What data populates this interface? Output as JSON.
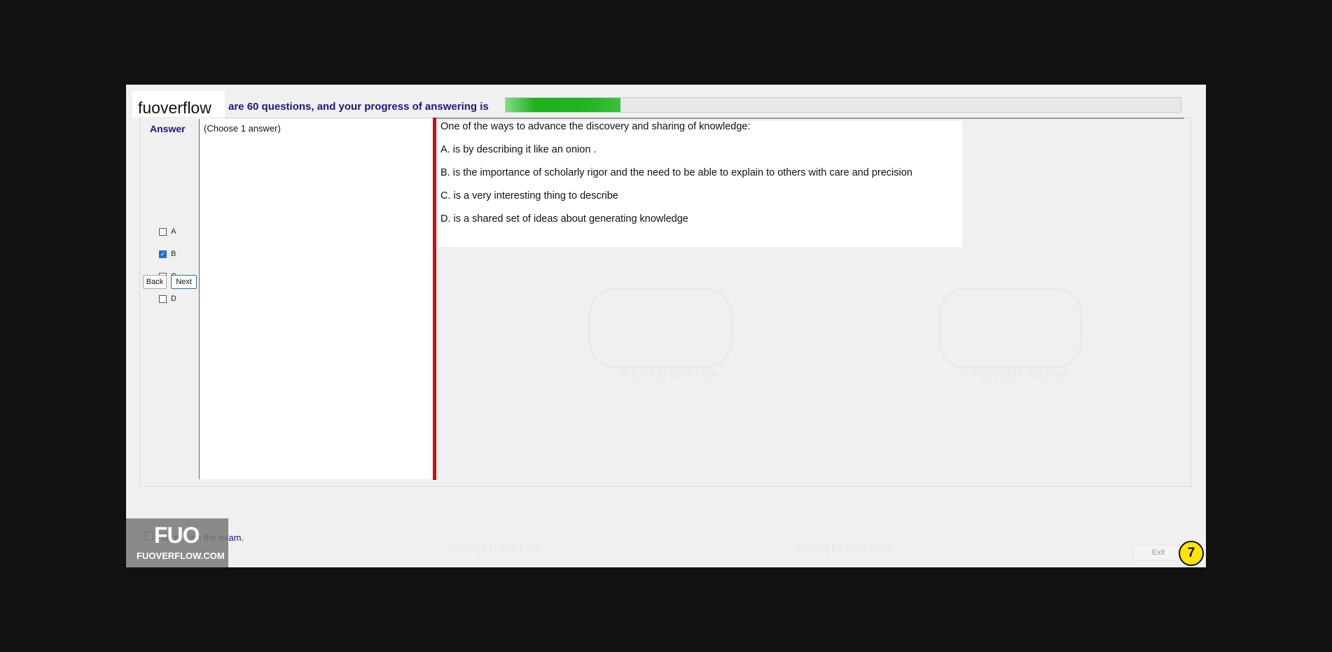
{
  "brand": {
    "name": "fuoverflow"
  },
  "header": {
    "progress_text": "are 60 questions, and your progress of answering is",
    "progress_fraction": 0.17
  },
  "answer": {
    "title": "Answer",
    "options": [
      {
        "label": "A",
        "checked": false
      },
      {
        "label": "B",
        "checked": true
      },
      {
        "label": "C",
        "checked": false
      },
      {
        "label": "D",
        "checked": false
      }
    ]
  },
  "nav": {
    "back_label": "Back",
    "next_label": "Next"
  },
  "multi_panel": {
    "instruction": "(Choose 1 answer)"
  },
  "question": {
    "text": "One of the ways to advance the discovery and sharing of knowledge:",
    "choices": [
      "A.  is by describing it like an onion .",
      "B.  is the importance of scholarly rigor and the need to be able to explain to others with care and precision",
      "C.  is a very interesting thing to describe",
      "D.  is a shared set of ideas about generating knowledge"
    ]
  },
  "footer": {
    "finish_text": "I want to finish the exam.",
    "finish_text_visible": "an to f  ish the exam.",
    "exit_label": "Exit",
    "page_number": "7"
  },
  "logo": {
    "mark": "FUO",
    "site": "FUOVERFLOW.COM"
  },
  "watermark": {
    "site": "FUOVERFLOW.COM"
  },
  "colors": {
    "accent_text": "#1a1a80",
    "progress": "#21b321",
    "divider": "#cc1111",
    "checked": "#1c6fd6",
    "badge": "#ffe400"
  }
}
